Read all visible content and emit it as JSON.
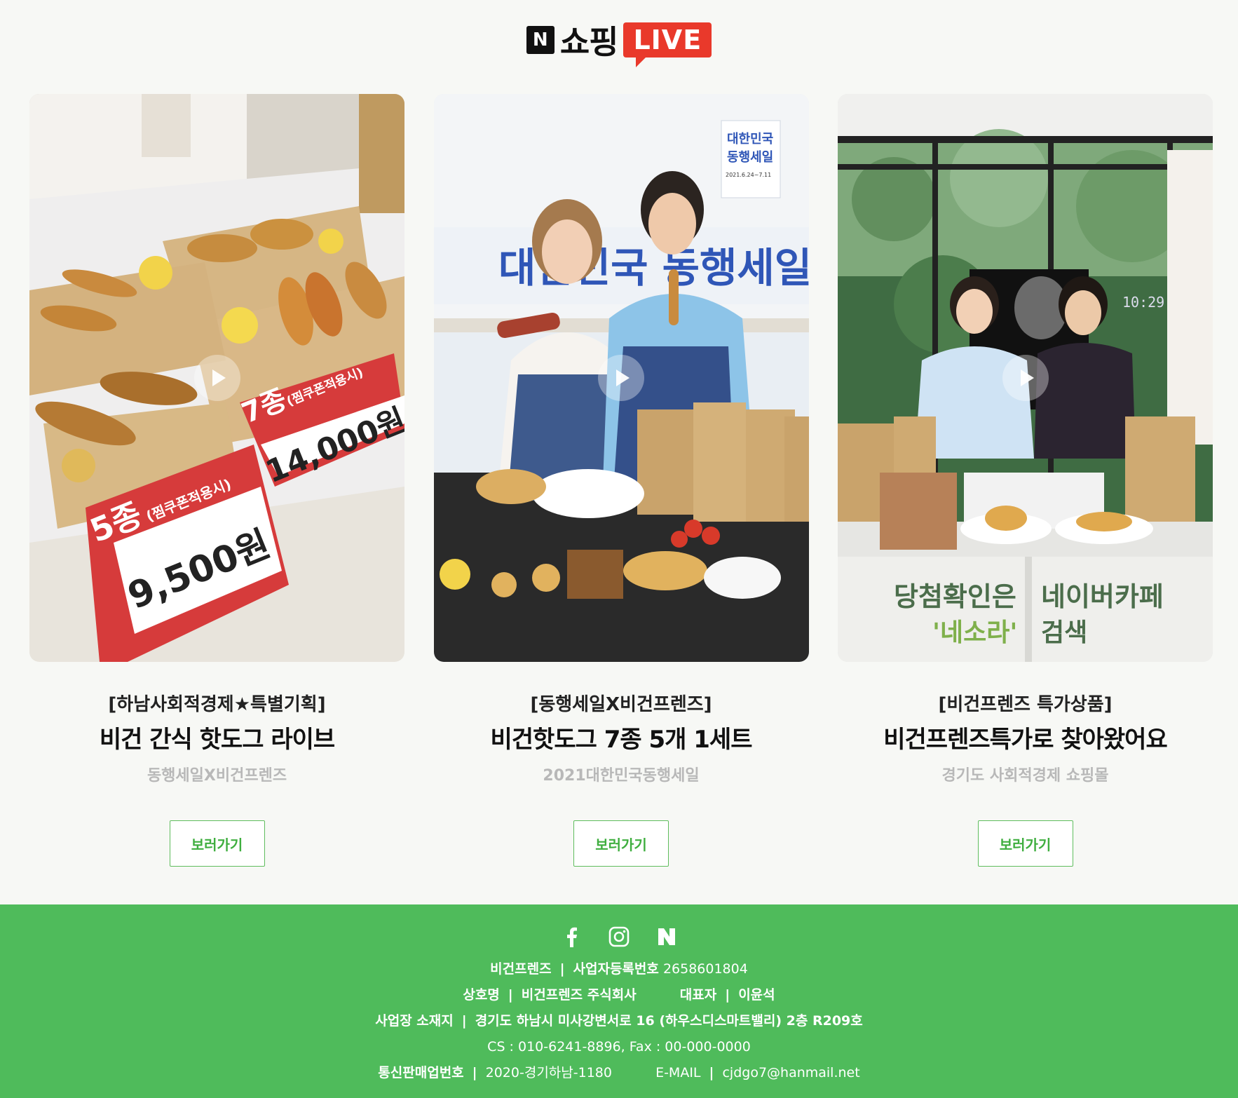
{
  "header": {
    "logo_n": "N",
    "logo_text": "쇼핑",
    "logo_live": "LIVE"
  },
  "cards": [
    {
      "sub_title": "[하남사회적경제★특별기획]",
      "title": "비건 간식 핫도그 라이브",
      "caption": "동행세일X비건프렌즈",
      "button": "보러가기",
      "sign_left_top": "5종",
      "sign_left_note": "(찜쿠폰적용시)",
      "sign_left_price": "9,500원",
      "sign_right_top": "7종",
      "sign_right_note": "(찜쿠폰적용시)",
      "sign_right_price": "14,000원"
    },
    {
      "sub_title": "[동행세일X비건프렌즈]",
      "title": "비건핫도그 7종 5개 1세트",
      "caption": "2021대한민국동행세일",
      "button": "보러가기",
      "banner_text": "대한민국 동행세일",
      "poster_line1": "대한민국",
      "poster_line2": "동행세일",
      "poster_date": "2021.6.24~7.11"
    },
    {
      "sub_title": "[비건프렌즈 특가상품]",
      "title": "비건프렌즈특가로 찾아왔어요",
      "caption": "경기도 사회적경제 쇼핑몰",
      "button": "보러가기",
      "clock": "10:29",
      "sign_a1": "당첨확인은",
      "sign_a2": "'네소라'",
      "sign_b1": "네이버카페",
      "sign_b2": "검색"
    }
  ],
  "footer": {
    "icons": [
      "facebook-icon",
      "instagram-icon",
      "naver-icon"
    ],
    "brand": "비건프렌즈",
    "sep": "|",
    "biz_label": "사업자등록번호",
    "biz_no": "2658601804",
    "company_label": "상호명",
    "company": "비건프렌즈 주식회사",
    "ceo_label": "대표자",
    "ceo": "이윤석",
    "addr_label": "사업장 소재지",
    "addr": "경기도 하남시 미사강변서로 16 (하우스디스마트밸리) 2층 R209호",
    "cs": "CS : 010-6241-8896, Fax : 00-000-0000",
    "mail_order_label": "통신판매업번호",
    "mail_order_no": "2020-경기하남-1180",
    "email_label": "E-MAIL",
    "email": "cjdgo7@hanmail.net"
  },
  "colors": {
    "brand_green": "#4fbb5b",
    "live_red": "#e9392b",
    "button_text": "#3fae3f"
  }
}
